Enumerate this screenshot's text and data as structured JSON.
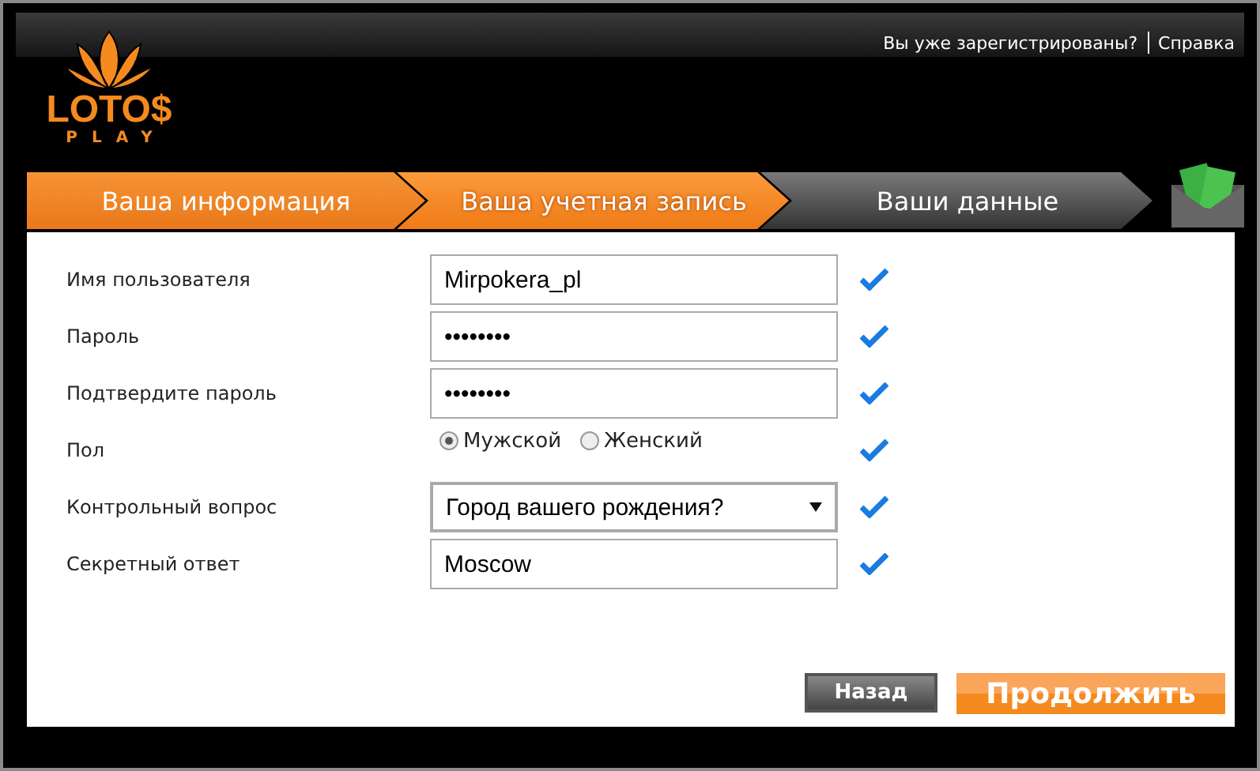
{
  "top_links": [
    "Вы уже зарегистрированы?",
    "Справка"
  ],
  "logo": {
    "name": "LOTO$",
    "sub": "PLAY"
  },
  "steps": [
    {
      "label": "Ваша информация",
      "selected": false,
      "completed": true
    },
    {
      "label": "Ваша учетная запись",
      "selected": true,
      "completed": false
    },
    {
      "label": "Ваши данные",
      "selected": false,
      "completed": false
    }
  ],
  "fields": [
    {
      "label": "Имя пользователя",
      "kind": "text",
      "value": "Mirpokera_pl",
      "valid": true
    },
    {
      "label": "Пароль",
      "kind": "password",
      "value": "••••••••",
      "valid": true
    },
    {
      "label": "Подтвердите пароль",
      "kind": "password",
      "value": "••••••••",
      "valid": true
    },
    {
      "label": "Пол",
      "kind": "radio",
      "options": [
        {
          "label": "Мужской",
          "selected": true
        },
        {
          "label": "Женский",
          "selected": false
        }
      ],
      "valid": true
    },
    {
      "label": "Контрольный вопрос",
      "kind": "select",
      "value": "Город вашего рождения?",
      "valid": true
    },
    {
      "label": "Секретный ответ",
      "kind": "text",
      "value": "Moscow",
      "valid": true
    }
  ],
  "buttons": {
    "back": "Назад",
    "next": "Продолжить"
  }
}
